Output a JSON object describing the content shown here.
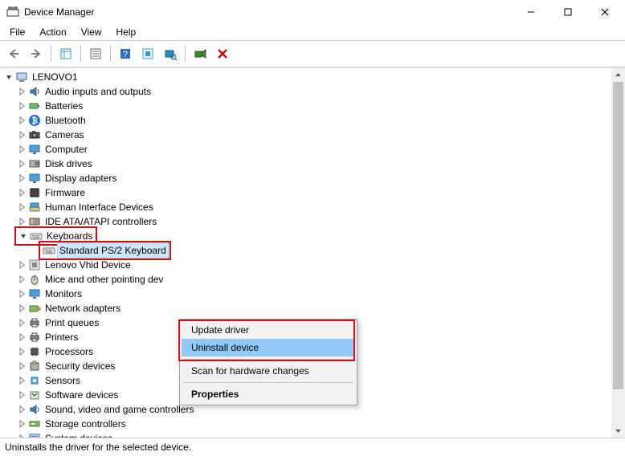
{
  "title": "Device Manager",
  "menubar": {
    "file": "File",
    "action": "Action",
    "view": "View",
    "help": "Help"
  },
  "tree": {
    "root": "LENOVO1",
    "categories": [
      "Audio inputs and outputs",
      "Batteries",
      "Bluetooth",
      "Cameras",
      "Computer",
      "Disk drives",
      "Display adapters",
      "Firmware",
      "Human Interface Devices",
      "IDE ATA/ATAPI controllers",
      "Keyboards",
      "Lenovo Vhid Device",
      "Mice and other pointing dev",
      "Monitors",
      "Network adapters",
      "Print queues",
      "Printers",
      "Processors",
      "Security devices",
      "Sensors",
      "Software devices",
      "Sound, video and game controllers",
      "Storage controllers",
      "System devices"
    ],
    "keyboards_child": "Standard PS/2 Keyboard"
  },
  "context_menu": {
    "update": "Update driver",
    "uninstall": "Uninstall device",
    "scan": "Scan for hardware changes",
    "properties": "Properties"
  },
  "statusbar": "Uninstalls the driver for the selected device."
}
